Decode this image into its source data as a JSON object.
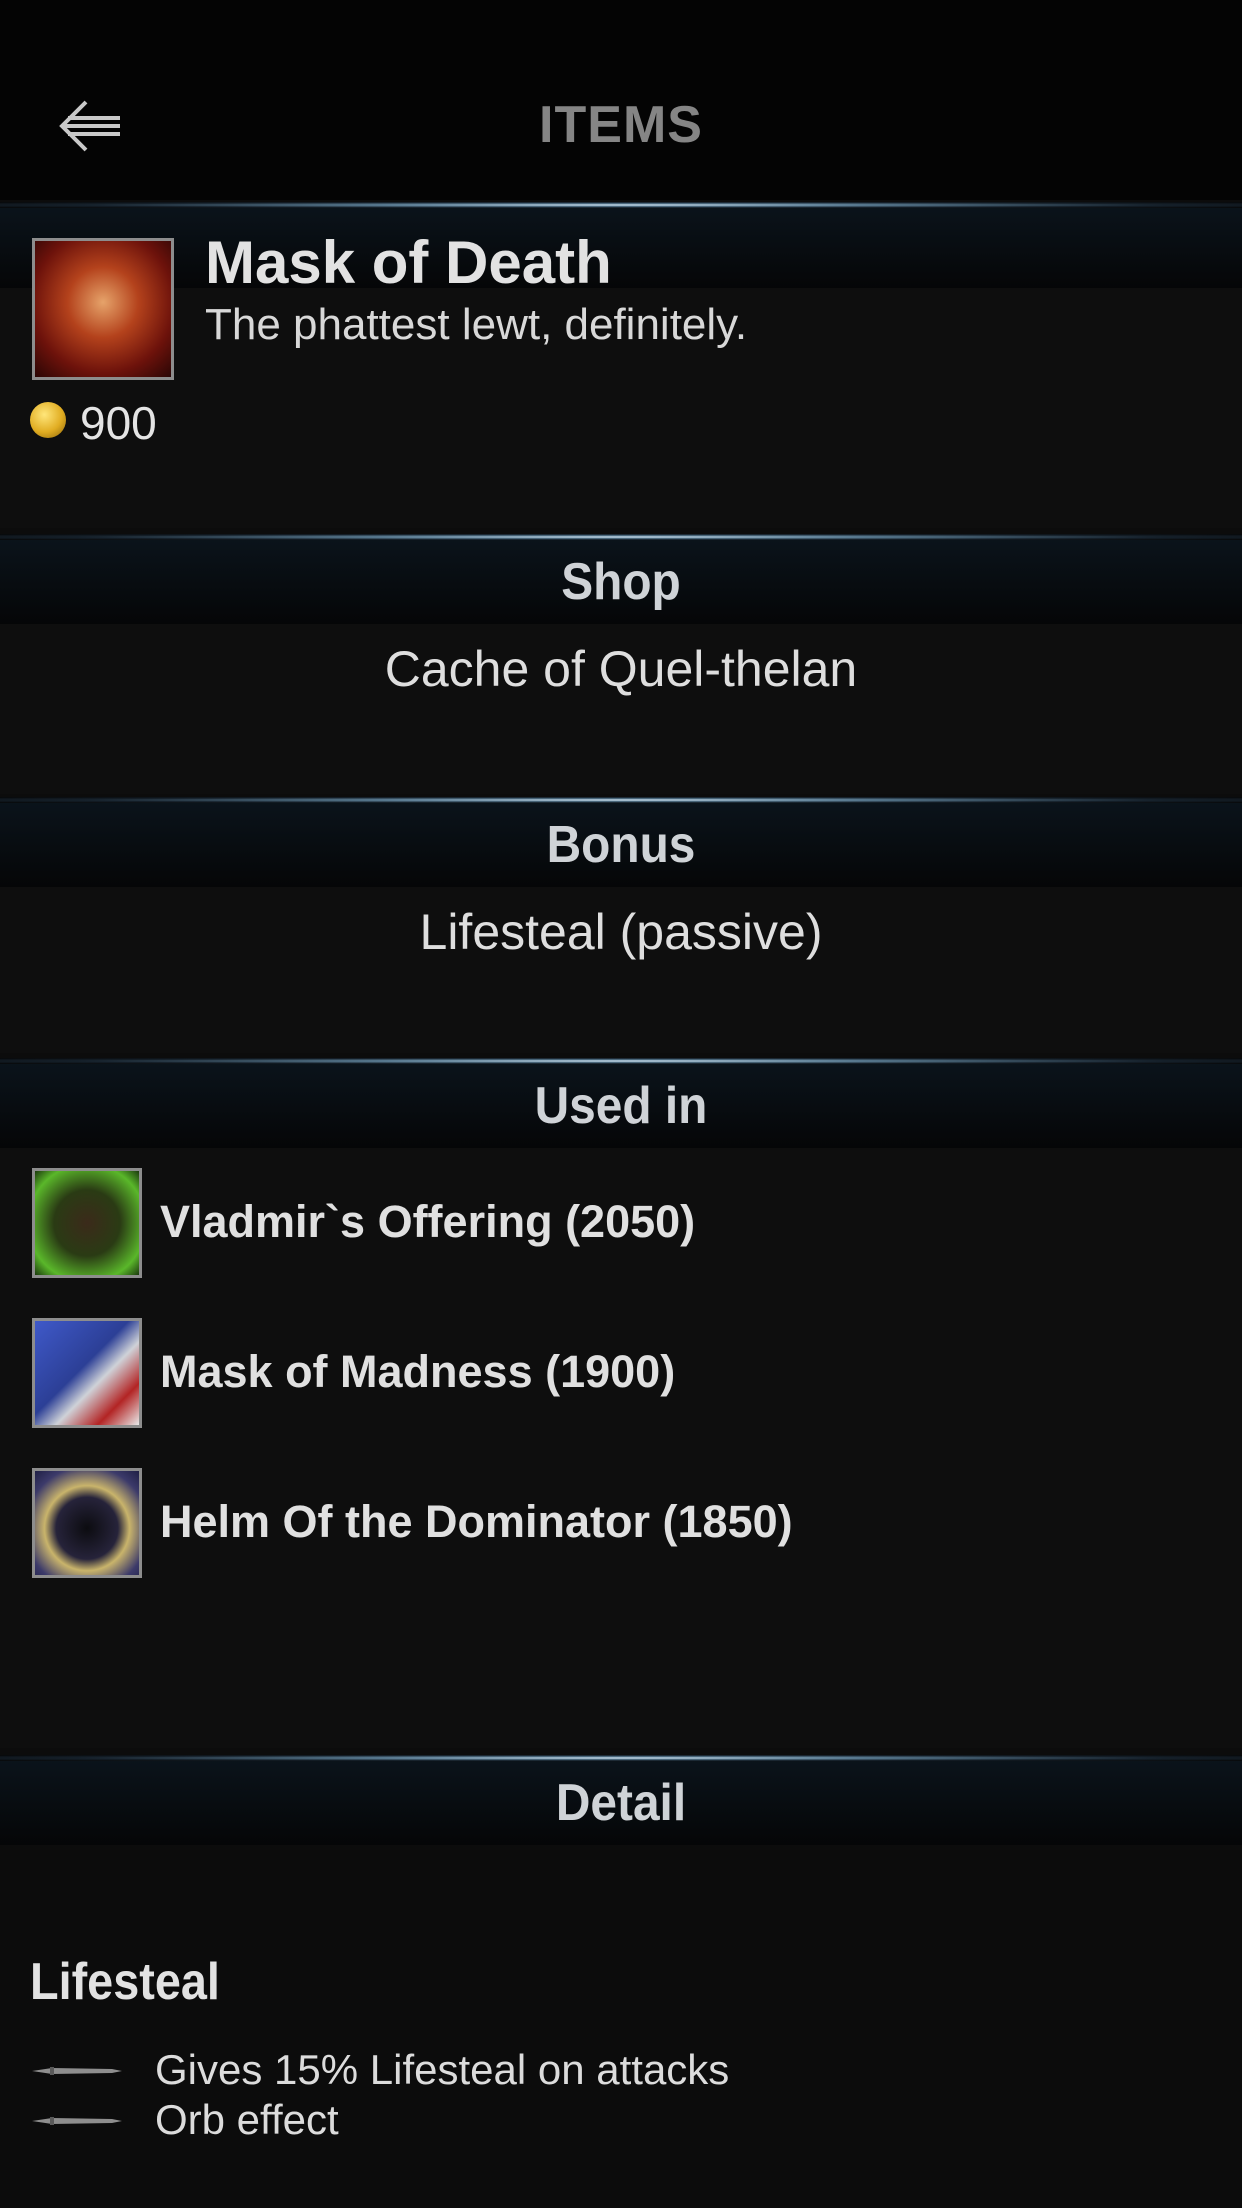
{
  "header": {
    "title": "ITEMS"
  },
  "item": {
    "name": "Mask of Death",
    "description": "The phattest lewt, definitely.",
    "price": "900"
  },
  "shop": {
    "heading": "Shop",
    "value": "Cache of Quel-thelan"
  },
  "bonus": {
    "heading": "Bonus",
    "value": "Lifesteal (passive)"
  },
  "used_in": {
    "heading": "Used in",
    "items": [
      {
        "label": "Vladmir`s Offering (2050)"
      },
      {
        "label": "Mask of Madness (1900)"
      },
      {
        "label": "Helm Of the Dominator (1850)"
      }
    ]
  },
  "detail": {
    "heading": "Detail",
    "section_title": "Lifesteal",
    "lines": [
      "Gives 15% Lifesteal on attacks",
      "Orb effect"
    ]
  },
  "colors": {
    "background": "#0c0c0c",
    "bar_glow": "#d3e6f4",
    "title_gray": "#858585"
  }
}
